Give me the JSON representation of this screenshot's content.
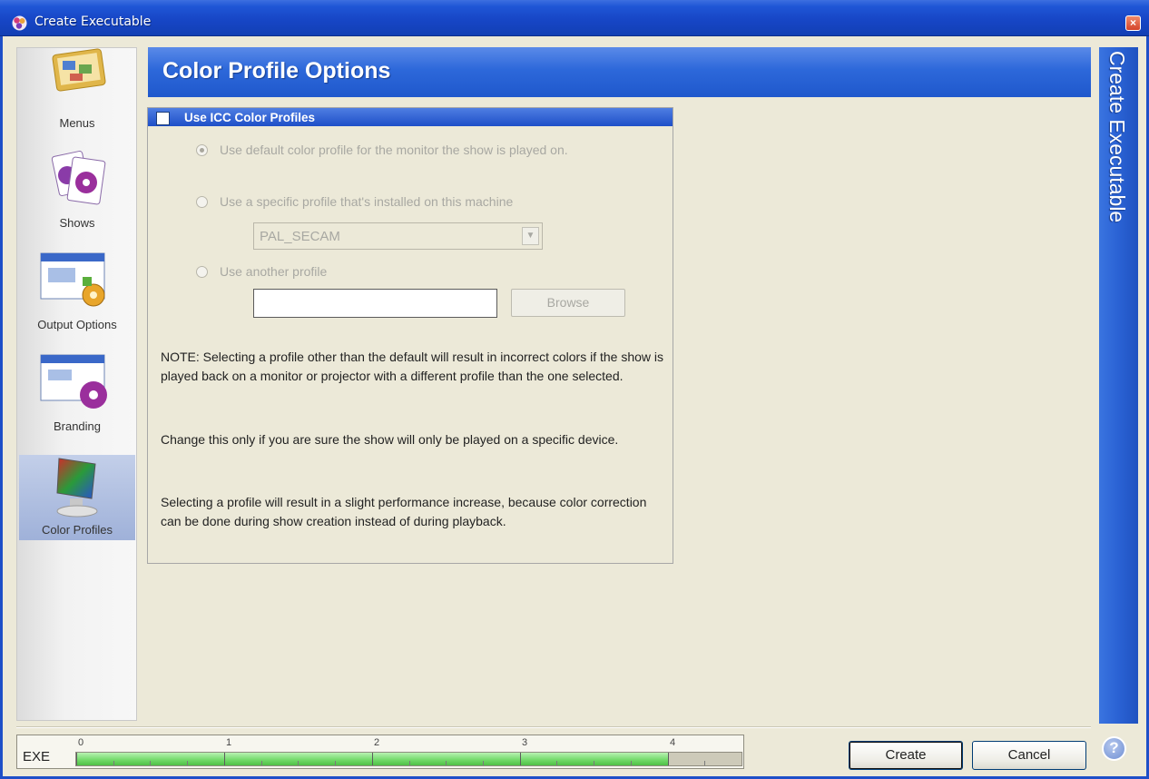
{
  "window": {
    "title": "Create Executable",
    "close_glyph": "×"
  },
  "header": {
    "title": "Color Profile Options"
  },
  "banner": {
    "text": "Create Executable",
    "help_glyph": "?"
  },
  "sidebar": {
    "items": [
      {
        "label": "Menus",
        "icon": "menus-icon",
        "selected": false
      },
      {
        "label": "Shows",
        "icon": "shows-icon",
        "selected": false
      },
      {
        "label": "Output Options",
        "icon": "output-options-icon",
        "selected": false
      },
      {
        "label": "Branding",
        "icon": "branding-icon",
        "selected": false
      },
      {
        "label": "Color Profiles",
        "icon": "color-profiles-icon",
        "selected": true
      }
    ]
  },
  "icc": {
    "checkbox_label": "Use ICC Color Profiles",
    "checked": false,
    "options": [
      {
        "label": "Use default color profile for the monitor the show is played on.",
        "checked": true
      },
      {
        "label": "Use a specific profile that's installed on this machine",
        "checked": false
      },
      {
        "label": "Use another profile",
        "checked": false
      }
    ],
    "profile_select": {
      "value": "PAL_SECAM",
      "arrow_glyph": "▼"
    },
    "other_profile_path": {
      "value": ""
    },
    "browse_label": "Browse",
    "notes": [
      "NOTE: Selecting a profile other than the default will result in incorrect colors if the show is played back on a monitor or projector with a different profile than the one selected.",
      "Change this only if you are sure the show will only be played on a specific device.",
      "Selecting a profile will result in a slight performance increase, because color correction can be done during show creation instead of during playback."
    ]
  },
  "gauge": {
    "label": "EXE",
    "ticks": [
      "0",
      "1",
      "2",
      "3",
      "4"
    ],
    "max": 4.5,
    "value": 4
  },
  "buttons": {
    "create": "Create",
    "cancel": "Cancel"
  },
  "colors": {
    "accent": "#1e4fc8",
    "gauge_fill": "#6fd866"
  }
}
